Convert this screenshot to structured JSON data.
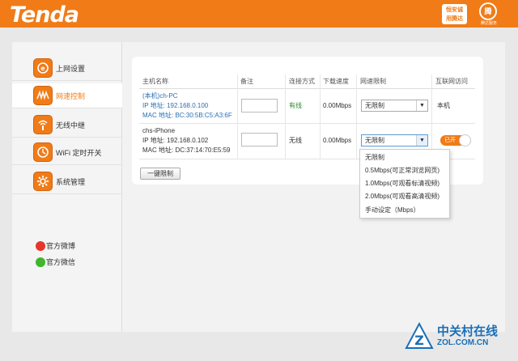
{
  "brand": {
    "logo": "Tenda",
    "badge_a_line1": "恒安诚",
    "badge_a_line2": "用腾达",
    "badge_b_mark": "腾",
    "badge_b_text": "腾达服务"
  },
  "sidebar": {
    "items": [
      {
        "label": "上网设置",
        "icon": "globe-icon"
      },
      {
        "label": "网速控制",
        "icon": "speed-wave-icon"
      },
      {
        "label": "无线中继",
        "icon": "wifi-relay-icon"
      },
      {
        "label": "WiFi 定时开关",
        "icon": "clock-icon"
      },
      {
        "label": "系统管理",
        "icon": "gear-icon"
      }
    ],
    "weibo": "官方微博",
    "wechat": "官方微信"
  },
  "table": {
    "headers": [
      "主机名称",
      "备注",
      "连接方式",
      "下载速度",
      "网速限制",
      "互联网访问"
    ],
    "rows": [
      {
        "name": "(本机)ch-PC",
        "ip": "IP 地址: 192.168.0.100",
        "mac": "MAC 地址: BC:30:5B:C5:A3:6F",
        "note": "",
        "conn": "有线",
        "speed": "0.00Mbps",
        "limit": "无限制",
        "access": "本机"
      },
      {
        "name": "chs-iPhone",
        "ip": "IP 地址: 192.168.0.102",
        "mac": "MAC 地址: DC:37:14:70:E5:59",
        "note": "",
        "conn": "无线",
        "speed": "0.00Mbps",
        "limit": "无限制",
        "access": "已开"
      }
    ]
  },
  "dropdown": {
    "options": [
      "无限制",
      "0.5Mbps(可正常浏览网页)",
      "1.0Mbps(可观看标清视频)",
      "2.0Mbps(可观看高清视频)",
      "手动设定（Mbps）"
    ]
  },
  "limit_all_button": "一键限制",
  "watermark": {
    "line1": "中关村在线",
    "line2": "ZOL.COM.CN"
  },
  "colors": {
    "brand_orange": "#f07b17",
    "link_blue": "#2a6fb5",
    "wired_green": "#2e8b2e",
    "watermark_blue": "#1a6fb7"
  }
}
